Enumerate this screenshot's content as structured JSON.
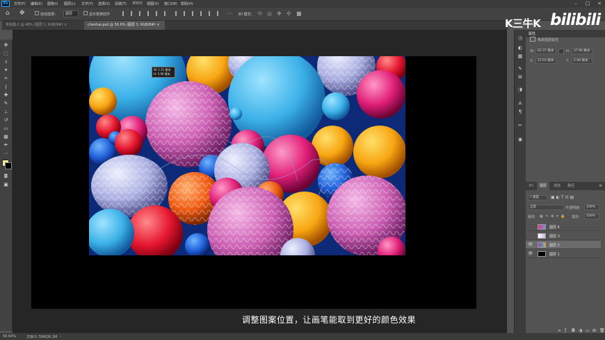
{
  "menu": {
    "items": [
      "文件(F)",
      "编辑(E)",
      "图像(I)",
      "图层(L)",
      "文字(Y)",
      "选择(S)",
      "滤镜(T)",
      "3D(D)",
      "视图(V)",
      "窗口(W)",
      "帮助(H)"
    ]
  },
  "options": {
    "auto_select_label": "自动选择：",
    "auto_select_value": "图层",
    "show_transform_label": "显示变换控件",
    "three_d_label": "3D 模式："
  },
  "tabs": [
    {
      "label": "未标题-2 @ 48% (图层 1, RGB/8#) ×"
    },
    {
      "label": "chenhai.psd @ 56.6% (图层 3, RGB/8#) ×"
    }
  ],
  "tooltip": {
    "line1": "W: 1.31 厘米",
    "line2": "H: 5.06 厘米"
  },
  "subtitle": "调整图案位置，让画笔能取到更好的颜色效果",
  "watermark": {
    "k_text": "K三牛K",
    "bili_text": "bilibili"
  },
  "properties": {
    "header": "属性",
    "doc_label": "像素图层属性",
    "w_label": "W:",
    "w_value": "62.37 厘米",
    "h_label": "H:",
    "h_value": "37.99 厘米",
    "x_label": "X:",
    "x_value": "12.93 厘米",
    "y_label": "Y:",
    "y_value": "5.08 厘米"
  },
  "layers_panel": {
    "tabs": [
      "3D",
      "图层",
      "通道",
      "路径"
    ],
    "filter_label": "类型",
    "blend_mode": "正常",
    "opacity_label": "不透明度:",
    "opacity_value": "100%",
    "lock_label": "锁定:",
    "fill_label": "填充:",
    "fill_value": "100%",
    "layers": [
      {
        "name": "图层 4",
        "visible": false,
        "selected": false
      },
      {
        "name": "图层 3",
        "visible": false,
        "selected": false
      },
      {
        "name": "图层 2",
        "visible": true,
        "selected": true
      },
      {
        "name": "图层 1",
        "visible": true,
        "selected": false
      }
    ]
  },
  "status": {
    "zoom": "56.64%",
    "doc_info": "文档:5.70M/26.3M"
  },
  "colors": {
    "foreground": "#f5e6a0",
    "background": "#000000",
    "app_bg": "#535353",
    "canvas_bg": "#262626"
  }
}
